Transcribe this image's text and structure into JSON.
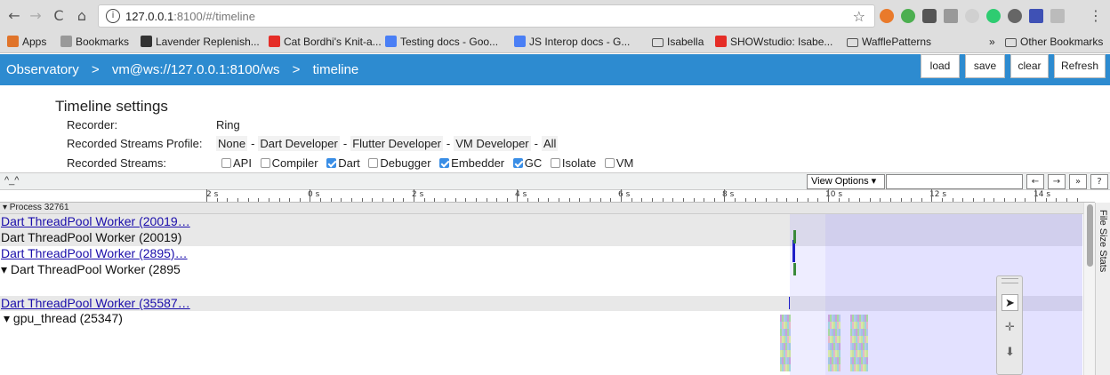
{
  "browser": {
    "url_host": "127.0.0.1",
    "url_rest": ":8100/#/timeline",
    "info_icon": "info-icon",
    "bookmarks": [
      {
        "label": "Apps",
        "icon": "apps-grid-icon",
        "color": "#e0742a"
      },
      {
        "label": "Bookmarks",
        "icon": "star-icon",
        "color": "#888888"
      },
      {
        "label": "Lavender Replenish...",
        "icon": "site-icon",
        "color": "#333333"
      },
      {
        "label": "Cat Bordhi's Knit-a...",
        "icon": "youtube-icon",
        "color": "#e52d27"
      },
      {
        "label": "Testing docs - Goo...",
        "icon": "gdocs-icon",
        "color": "#4a7ff5"
      },
      {
        "label": "JS Interop docs - G...",
        "icon": "gdocs-icon",
        "color": "#4a7ff5"
      },
      {
        "label": "Isabella",
        "icon": "folder-icon",
        "color": "#555555"
      },
      {
        "label": "SHOWstudio: Isabe...",
        "icon": "youtube-icon",
        "color": "#e52d27"
      },
      {
        "label": "WafflePatterns",
        "icon": "folder-icon",
        "color": "#555555"
      }
    ],
    "overflow": "»",
    "other_bookmarks": "Other Bookmarks"
  },
  "observatory": {
    "crumbs": [
      "Observatory",
      ">",
      "vm@ws://127.0.0.1:8100/ws",
      ">",
      "timeline"
    ],
    "buttons": [
      "load",
      "save",
      "clear",
      "Refresh"
    ]
  },
  "settings": {
    "title": "Timeline settings",
    "recorder_label": "Recorder:",
    "recorder_value": "Ring",
    "profile_label": "Recorded Streams Profile:",
    "profiles": [
      "None",
      "Dart Developer",
      "Flutter Developer",
      "VM Developer",
      "All"
    ],
    "streams_label": "Recorded Streams:",
    "streams": [
      {
        "name": "API",
        "checked": false
      },
      {
        "name": "Compiler",
        "checked": false
      },
      {
        "name": "Dart",
        "checked": true
      },
      {
        "name": "Debugger",
        "checked": false
      },
      {
        "name": "Embedder",
        "checked": true
      },
      {
        "name": "GC",
        "checked": true
      },
      {
        "name": "Isolate",
        "checked": false
      },
      {
        "name": "VM",
        "checked": false
      }
    ]
  },
  "trace": {
    "caret": "^_^",
    "view_options": "View Options ▾",
    "nav_buttons": [
      "←",
      "→",
      "»",
      "?"
    ],
    "ruler_labels": [
      "2 s",
      "0 s",
      "2 s",
      "4 s",
      "6 s",
      "8 s",
      "10 s",
      "12 s",
      "14 s"
    ],
    "process": "▾ Process 32761",
    "tracks": [
      {
        "label": "Dart ThreadPool Worker (20019…",
        "link": true
      },
      {
        "label": "Dart ThreadPool Worker (20019)",
        "link": false
      },
      {
        "label": "Dart ThreadPool Worker (2895)…",
        "link": true
      },
      {
        "label": "▾  Dart ThreadPool Worker (2895",
        "link": false
      },
      {
        "label": "Dart ThreadPool Worker (35587…",
        "link": true
      },
      {
        "label": "▾  gpu_thread (25347)",
        "link": false
      }
    ],
    "sidebar_label": "File Size Stats"
  }
}
